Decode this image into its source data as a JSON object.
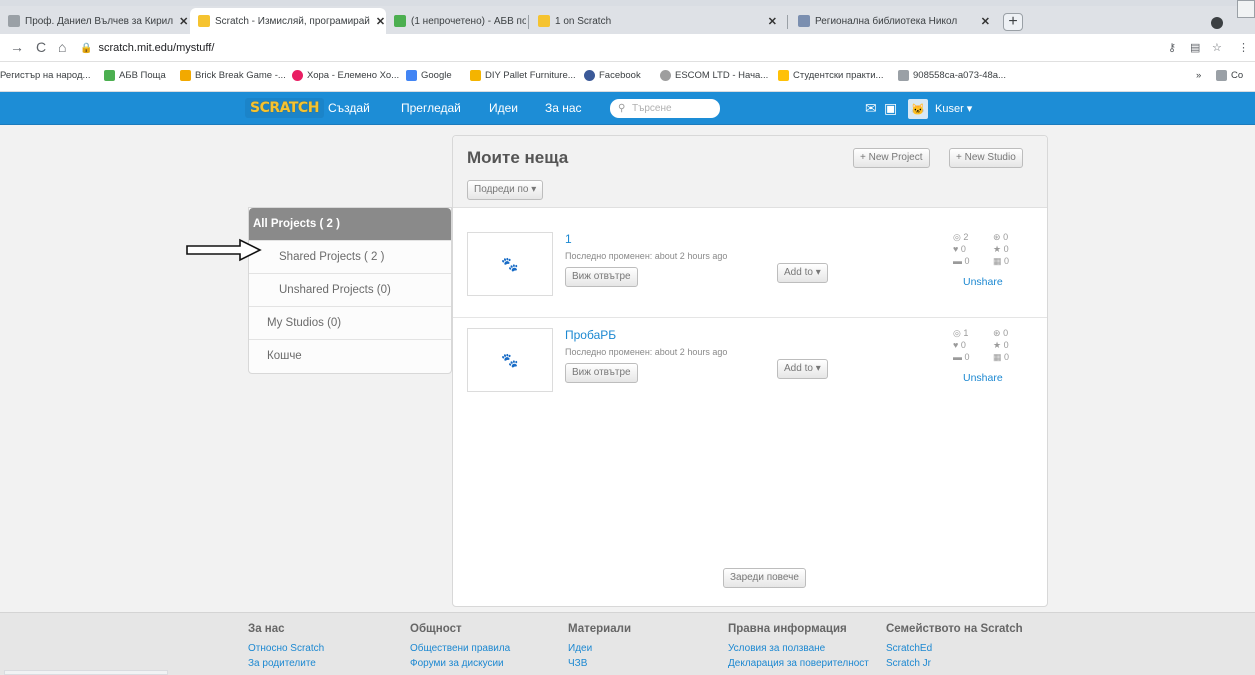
{
  "browser": {
    "tabs": [
      {
        "title": "Проф. Даниел Вълчев за Кирил",
        "color": "#9aa0a6"
      },
      {
        "title": "Scratch - Измисляй, програмирай",
        "color": "#f5c330"
      },
      {
        "title": "(1 непрочетено) - АБВ поща",
        "color": "#4caf50"
      },
      {
        "title": "1 on Scratch",
        "color": "#f5c330"
      },
      {
        "title": "Регионална библиотека Никол",
        "color": "#7b8fb0"
      }
    ],
    "url": "scratch.mit.edu/mystuff/",
    "bookmarks": [
      {
        "label": "Регистър на народ...",
        "color": "#9aa0a6"
      },
      {
        "label": "АБВ Поща",
        "color": "#4caf50"
      },
      {
        "label": "Brick Break Game -...",
        "color": "#f2a900"
      },
      {
        "label": "Хора - Елемено Хо...",
        "color": "#e91e63"
      },
      {
        "label": "Google",
        "color": "#4285f4"
      },
      {
        "label": "DIY Pallet Furniture...",
        "color": "#f4b400"
      },
      {
        "label": "Facebook",
        "color": "#3b5998"
      },
      {
        "label": "ESCOM LTD - Нача...",
        "color": "#9e9e9e"
      },
      {
        "label": "Студентски практи...",
        "color": "#ffc107"
      },
      {
        "label": "908558ca-a073-48a...",
        "color": "#9aa0a6"
      }
    ],
    "bookmarks_more": "Co"
  },
  "nav": {
    "logo": "SCRATCH",
    "create": "Създай",
    "explore": "Прегледай",
    "ideas": "Идеи",
    "about": "За нас",
    "search_placeholder": "Търсене",
    "username": "Kuser"
  },
  "sidebar": {
    "items": [
      {
        "label": "All Projects ( 2 )"
      },
      {
        "label": "Shared Projects ( 2 )"
      },
      {
        "label": "Unshared Projects (0)"
      },
      {
        "label": "My Studios (0)"
      },
      {
        "label": "Кошче"
      }
    ]
  },
  "panel": {
    "title": "Моите неща",
    "new_project": "+ New Project",
    "new_studio": "+ New Studio",
    "sort_by": "Подреди по",
    "load_more": "Зареди повече"
  },
  "projects": [
    {
      "title": "1",
      "modified": "Последно променен: about 2 hours ago",
      "see_inside": "Виж отвътре",
      "add_to": "Add to",
      "views": "2",
      "remixes": "0",
      "loves": "0",
      "favorites": "0",
      "comments": "0",
      "studios": "0",
      "unshare": "Unshare"
    },
    {
      "title": "ПробаРБ",
      "modified": "Последно променен: about 2 hours ago",
      "see_inside": "Виж отвътре",
      "add_to": "Add to",
      "views": "1",
      "remixes": "0",
      "loves": "0",
      "favorites": "0",
      "comments": "0",
      "studios": "0",
      "unshare": "Unshare"
    }
  ],
  "footer": {
    "about": {
      "heading": "За нас",
      "links": [
        "Относно Scratch",
        "За родителите"
      ]
    },
    "community": {
      "heading": "Общност",
      "links": [
        "Обществени правила",
        "Форуми за дискусии"
      ]
    },
    "resources": {
      "heading": "Материали",
      "links": [
        "Идеи",
        "ЧЗВ"
      ]
    },
    "legal": {
      "heading": "Правна информация",
      "links": [
        "Условия за ползване",
        "Декларация за поверителност"
      ]
    },
    "family": {
      "heading": "Семейството на Scratch",
      "links": [
        "ScratchEd",
        "Scratch Jr"
      ]
    }
  }
}
